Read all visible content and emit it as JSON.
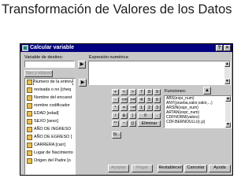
{
  "slide": {
    "title": "Transformación de Valores de los Datos"
  },
  "dialog": {
    "title": "Calcular variable",
    "target_variable_label": "Variable de destino:",
    "type_label_button": "Tipo y etiqueta...",
    "expression_label": "Expresión numérica:",
    "variables": [
      "Numero de la entrev",
      "revisada o no [cheq",
      "Nombre del encuest",
      "nombre codificador",
      "EDAD [edad]",
      "SEXO [sexo]",
      "AÑO DE INGRESO",
      "AÑO DE EGRESO [",
      "CARRERA [carr]",
      "Lugar de Nacimiento",
      "Origen del Padre [o"
    ],
    "keypad": [
      [
        "+",
        "<",
        ">",
        "7",
        "8",
        "9"
      ],
      [
        "-",
        "<=",
        ">=",
        "4",
        "5",
        "6"
      ],
      [
        "*",
        "=",
        "~=",
        "1",
        "2",
        "3"
      ],
      [
        "/",
        "&",
        "|",
        "0",
        "."
      ],
      [
        "**",
        "~",
        "()"
      ]
    ],
    "delete_button": "Eliminar",
    "functions_label": "Funciones:",
    "functions": [
      "ABS(expr_num)",
      "ANY(prueba,valor,valor,...)",
      "ARSIN(expr_num)",
      "ARTAN(expr_num)",
      "CDFNORM(valorz)",
      "CDF.BERNOULLI(c,p)"
    ],
    "if_button": "Si...",
    "buttons": {
      "ok": "Aceptar",
      "paste": "Pegar",
      "reset": "Restablecer",
      "cancel": "Cancelar",
      "help": "Ayuda"
    }
  },
  "colors": {
    "titlebar": "#000080",
    "dialog_bg": "#c8c8c8",
    "var_icon": "#e8c050"
  }
}
